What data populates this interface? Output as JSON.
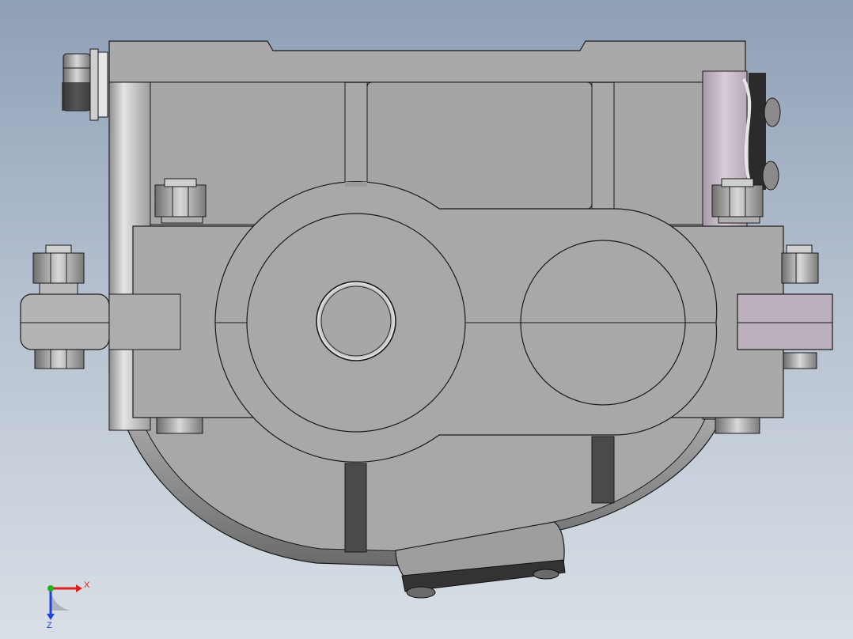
{
  "viewport": {
    "background_top": "#8e9fb6",
    "background_bottom": "#d9dfe6"
  },
  "model": {
    "body_color": "#a8a8a8",
    "edge_color": "#1a1a1a",
    "shadow_color": "#474747",
    "highlight_color": "#e2e2e2",
    "accent_color": "#b9a6b6"
  },
  "triad": {
    "x_label": "X",
    "z_label": "Z",
    "x_color": "#e02020",
    "y_color": "#20b020",
    "z_color": "#2040e0"
  }
}
